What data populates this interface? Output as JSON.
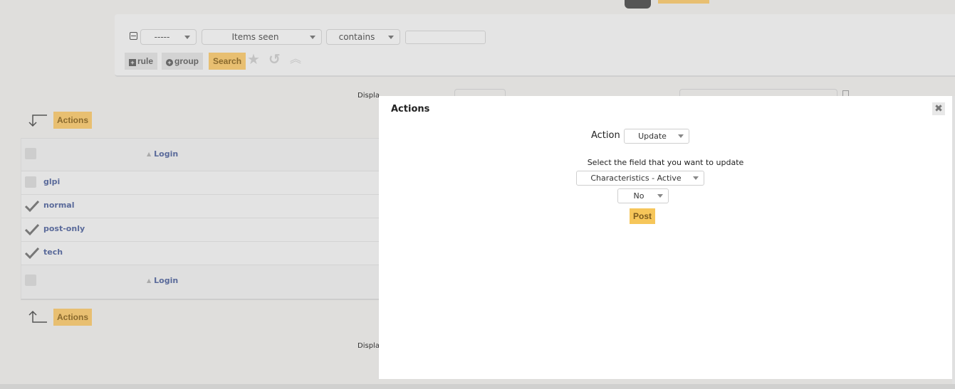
{
  "top": {
    "dark_button": "",
    "yellow_bar": ""
  },
  "search": {
    "link_select": "-----",
    "field_select": "Items seen",
    "operator_select": "contains",
    "value_input": "",
    "rule_button": "rule",
    "group_button": "group",
    "search_button": "Search",
    "icons": [
      "star-icon",
      "undo-icon",
      "collapse-icon"
    ]
  },
  "list": {
    "display_label_top": "Displa",
    "display_label_bottom": "Displa",
    "actions_top": "Actions",
    "actions_bottom": "Actions",
    "column_header": "Login",
    "column_footer": "Login",
    "rows": [
      {
        "login": "glpi",
        "checked": false,
        "status": "checkbox"
      },
      {
        "login": "normal",
        "checked": true,
        "status": "check"
      },
      {
        "login": "post-only",
        "checked": true,
        "status": "check"
      },
      {
        "login": "tech",
        "checked": true,
        "status": "check"
      }
    ]
  },
  "modal": {
    "title": "Actions",
    "close": "✖",
    "action_label": "Action",
    "action_value": "Update",
    "field_note": "Select the field that you want to update",
    "field_value": "Characteristics - Active",
    "value_value": "No",
    "post_button": "Post"
  },
  "colors": {
    "accent": "#e8bf71",
    "post": "#f6c65a",
    "link": "#5a6a9a",
    "background": "#dfdedc"
  }
}
